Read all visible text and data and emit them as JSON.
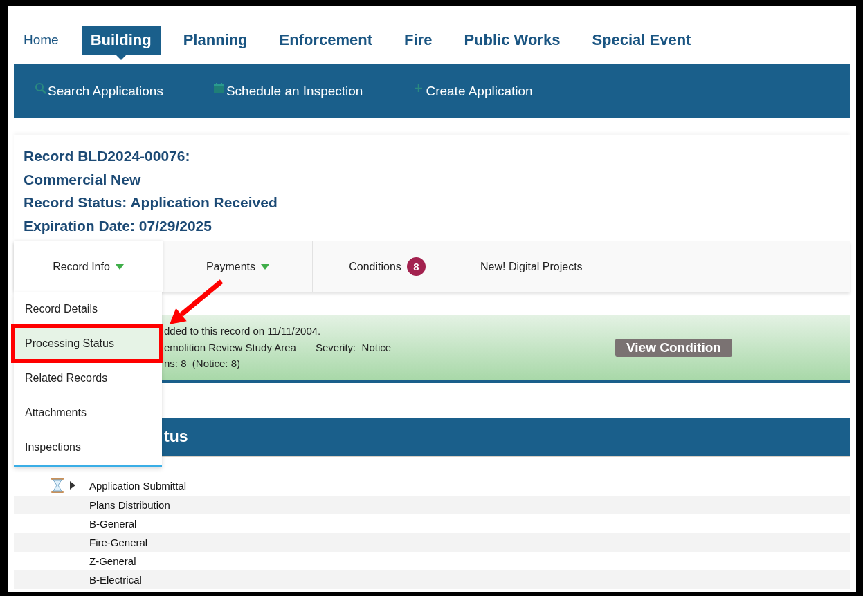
{
  "nav": [
    {
      "label": "Home",
      "selected": false
    },
    {
      "label": "Building",
      "selected": true
    },
    {
      "label": "Planning",
      "selected": false
    },
    {
      "label": "Enforcement",
      "selected": false
    },
    {
      "label": "Fire",
      "selected": false
    },
    {
      "label": "Public Works",
      "selected": false
    },
    {
      "label": "Special Event",
      "selected": false
    }
  ],
  "subnav": [
    {
      "label": "Search Applications",
      "kind": "search"
    },
    {
      "label": "Schedule an Inspection",
      "kind": "schedule"
    },
    {
      "label": "Create Application",
      "kind": "create"
    }
  ],
  "record_header": [
    "Record BLD2024-00076:",
    "Commercial New",
    "Record Status: Application Received",
    "Expiration Date: 07/29/2025"
  ],
  "tabs": [
    {
      "label": "Record Info",
      "kind": "dropdown",
      "expanded": true
    },
    {
      "label": "Payments",
      "kind": "dropdown",
      "expanded": false
    },
    {
      "label": "Conditions",
      "kind": "badge",
      "badge": "8"
    },
    {
      "label": "New! Digital Projects",
      "kind": "plain"
    }
  ],
  "record_info_menu": [
    {
      "label": "Record Details",
      "selected": false
    },
    {
      "label": "Processing Status",
      "selected": true
    },
    {
      "label": "Related Records",
      "selected": false
    },
    {
      "label": "Attachments",
      "selected": false
    },
    {
      "label": "Inspections",
      "selected": false
    }
  ],
  "condition_notice": {
    "lines": [
      [
        "dded to this record on 11/11/2004."
      ],
      [
        "emolition Review Study Area",
        "Severity:  Notice"
      ],
      [
        "ns: 8  (Notice: 8)"
      ]
    ],
    "button": "View Condition"
  },
  "section_heading": "tus",
  "workflow": [
    {
      "label": "Application Submittal",
      "in_progress": true,
      "expandable": true
    },
    {
      "label": "Plans Distribution",
      "in_progress": false,
      "expandable": false
    },
    {
      "label": "B-General",
      "in_progress": false,
      "expandable": false
    },
    {
      "label": "Fire-General",
      "in_progress": false,
      "expandable": false
    },
    {
      "label": "Z-General",
      "in_progress": false,
      "expandable": false
    },
    {
      "label": "B-Electrical",
      "in_progress": false,
      "expandable": false
    }
  ]
}
